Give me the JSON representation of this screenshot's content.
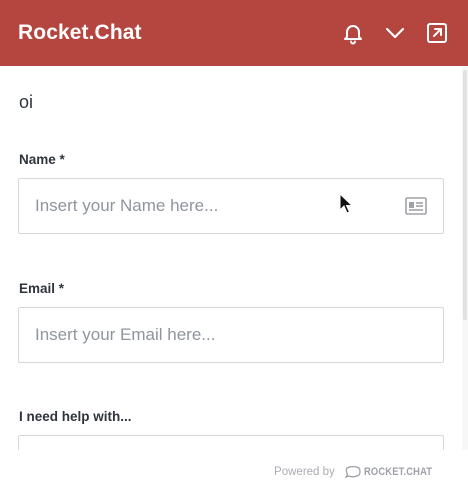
{
  "header": {
    "title": "Rocket.Chat",
    "icons": [
      "bell-icon",
      "chevron-down-icon",
      "popout-icon"
    ]
  },
  "message": "oi",
  "form": {
    "name": {
      "label": "Name *",
      "placeholder": "Insert your Name here...",
      "value": ""
    },
    "email": {
      "label": "Email *",
      "placeholder": "Insert your Email here...",
      "value": ""
    },
    "help": {
      "label": "I need help with..."
    }
  },
  "footer": {
    "powered_by": "Powered by",
    "brand": "ROCKET.CHAT"
  },
  "colors": {
    "header_bg": "#b5463f",
    "header_text": "#ffffff"
  }
}
